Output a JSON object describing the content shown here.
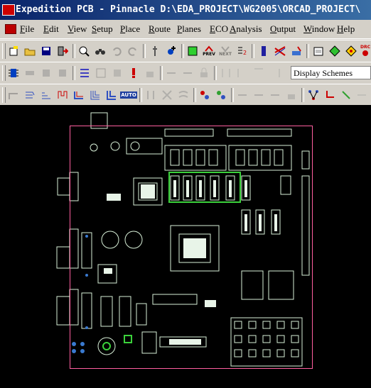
{
  "window": {
    "title": "Expedition PCB - Pinnacle  D:\\EDA_PROJECT\\WG2005\\ORCAD_PROJECT\\"
  },
  "menu": {
    "items": [
      "File",
      "Edit",
      "View",
      "Setup",
      "Place",
      "Route",
      "Planes",
      "ECO",
      "Analysis",
      "Output",
      "Window",
      "Help"
    ]
  },
  "toolbar1": {
    "buttons": [
      "new-icon",
      "open-icon",
      "save-icon",
      "exit-icon",
      "zoom-icon",
      "find-icon",
      "undo-icon",
      "redo-icon",
      "probe-icon",
      "add-icon",
      "select-icon",
      "previous-icon",
      "next-icon",
      "reports-icon",
      "layer-icon",
      "route-icon",
      "tools-icon",
      "properties-icon",
      "arrow-icon",
      "go-icon",
      "drc-icon"
    ],
    "prev_label": "PREV",
    "next_label": "NEXT",
    "drc_label": "DRC"
  },
  "toolbar2": {
    "display_scheme": "Display Schemes"
  },
  "toolbar3": {
    "auto_label": "AUTO"
  },
  "colors": {
    "title_bg": "#0a246a",
    "canvas_bg": "#000000",
    "board_outline": "#ff5fa0",
    "silkscreen": "#d8f0d8",
    "highlight": "#3bd13b"
  }
}
